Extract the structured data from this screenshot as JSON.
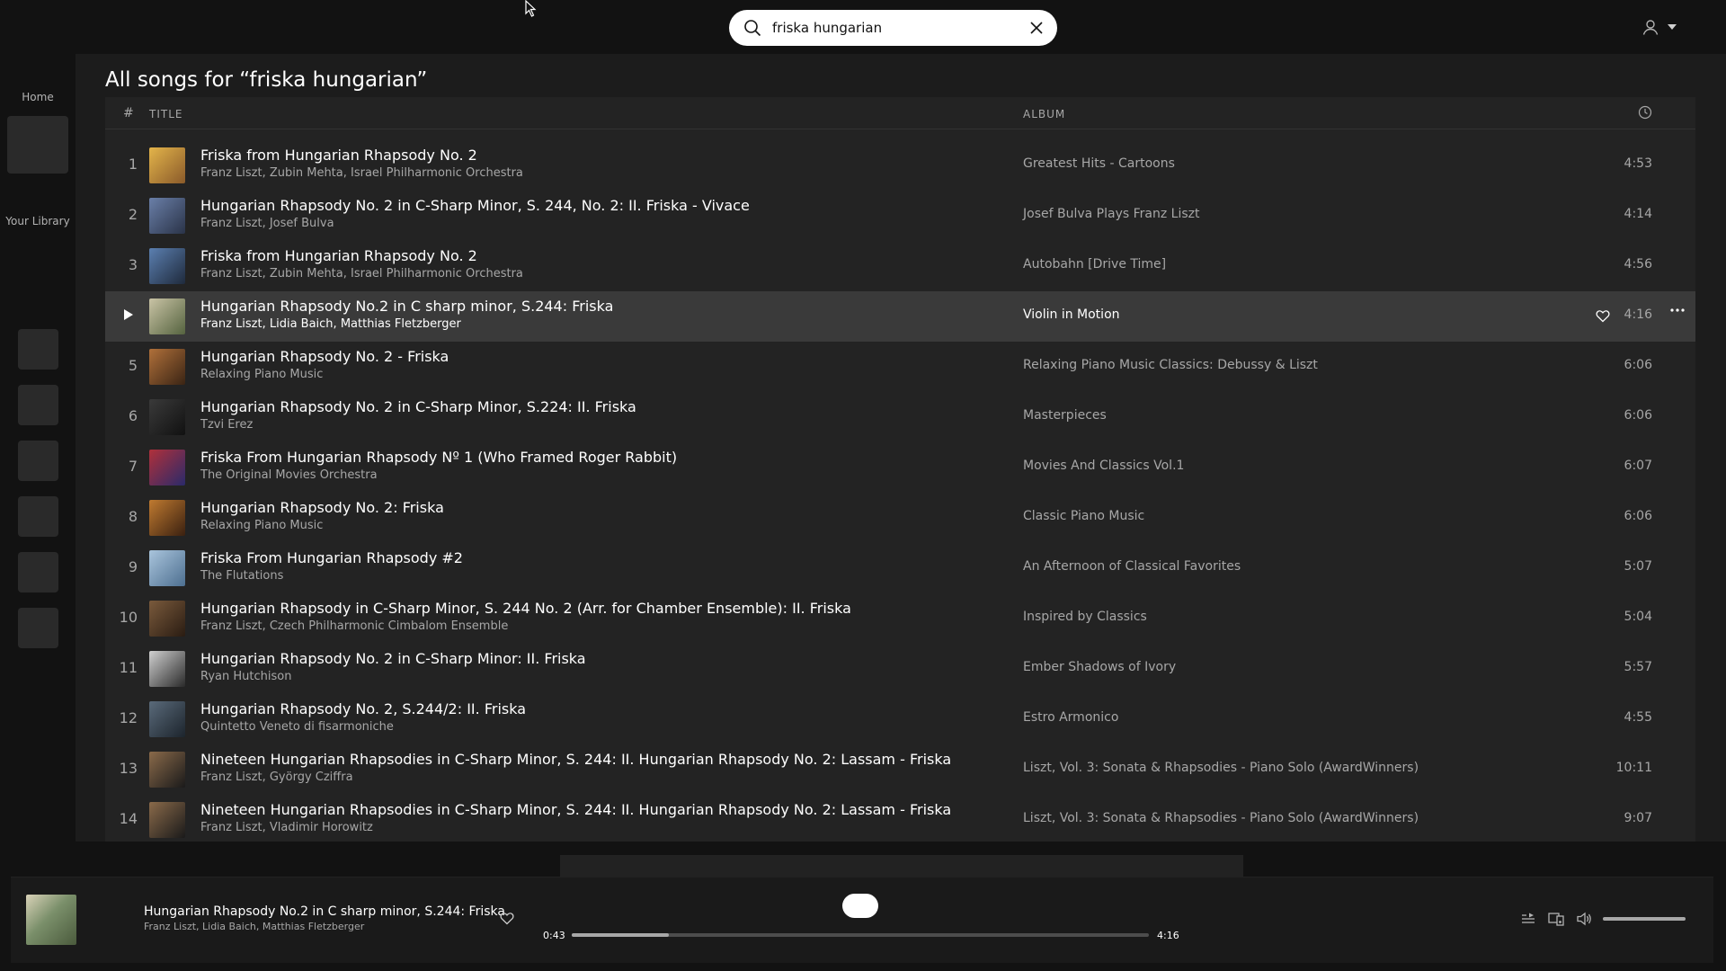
{
  "search": {
    "value": "friska hungarian",
    "placeholder": ""
  },
  "sidebar": {
    "home_label": "Home",
    "library_label": "Your Library"
  },
  "page_title": "All songs for “friska hungarian”",
  "table": {
    "headers": {
      "num": "#",
      "title": "TITLE",
      "album": "ALBUM",
      "duration_icon": "clock-icon"
    },
    "active_index": 3,
    "rows": [
      {
        "num": "1",
        "title": "Friska from Hungarian Rhapsody No. 2",
        "artists": "Franz Liszt, Zubin Mehta, Israel Philharmonic Orchestra",
        "album": "Greatest Hits - Cartoons",
        "duration": "4:53",
        "art": [
          "#e3b44a",
          "#8a5a2a"
        ]
      },
      {
        "num": "2",
        "title": "Hungarian Rhapsody No. 2 in C-Sharp Minor, S. 244, No. 2: II. Friska - Vivace",
        "artists": "Franz Liszt, Josef Bulva",
        "album": "Josef Bulva Plays Franz Liszt",
        "duration": "4:14",
        "art": [
          "#6a7fa8",
          "#2a3348"
        ]
      },
      {
        "num": "3",
        "title": "Friska from Hungarian Rhapsody No. 2",
        "artists": "Franz Liszt, Zubin Mehta, Israel Philharmonic Orchestra",
        "album": "Autobahn [Drive Time]",
        "duration": "4:56",
        "art": [
          "#5b7fb0",
          "#1f2a3c"
        ]
      },
      {
        "num": "",
        "title": "Hungarian Rhapsody No.2 in C sharp minor, S.244: Friska",
        "artists": "Franz Liszt, Lidia Baich, Matthias Fletzberger",
        "album": "Violin in Motion",
        "duration": "4:16",
        "art": [
          "#c9c3a5",
          "#55633f"
        ]
      },
      {
        "num": "5",
        "title": "Hungarian Rhapsody No. 2 - Friska",
        "artists": "Relaxing Piano Music",
        "album": "Relaxing Piano Music Classics: Debussy & Liszt",
        "duration": "6:06",
        "art": [
          "#b0703a",
          "#3a2414"
        ]
      },
      {
        "num": "6",
        "title": "Hungarian Rhapsody No. 2 in C-Sharp Minor, S.224: II. Friska",
        "artists": "Tzvi Erez",
        "album": "Masterpieces",
        "duration": "6:06",
        "art": [
          "#3a3a3a",
          "#111111"
        ]
      },
      {
        "num": "7",
        "title": "Friska From Hungarian Rhapsody Nº 1 (Who Framed Roger Rabbit)",
        "artists": "The Original Movies Orchestra",
        "album": "Movies And Classics Vol.1",
        "duration": "6:07",
        "art": [
          "#b0303a",
          "#2a2a6a"
        ]
      },
      {
        "num": "8",
        "title": "Hungarian Rhapsody No. 2: Friska",
        "artists": "Relaxing Piano Music",
        "album": "Classic Piano Music",
        "duration": "6:06",
        "art": [
          "#c07a30",
          "#3a2010"
        ]
      },
      {
        "num": "9",
        "title": "Friska From Hungarian Rhapsody #2",
        "artists": "The Flutations",
        "album": "An Afternoon of Classical Favorites",
        "duration": "5:07",
        "art": [
          "#a9c4dc",
          "#4d6f90"
        ]
      },
      {
        "num": "10",
        "title": "Hungarian Rhapsody in C-Sharp Minor, S. 244 No. 2 (Arr. for Chamber Ensemble): II. Friska",
        "artists": "Franz Liszt, Czech Philharmonic Cimbalom Ensemble",
        "album": "Inspired by Classics",
        "duration": "5:04",
        "art": [
          "#7a5a3c",
          "#2a1c12"
        ]
      },
      {
        "num": "11",
        "title": "Hungarian Rhapsody No. 2 in C-Sharp Minor: II. Friska",
        "artists": "Ryan Hutchison",
        "album": "Ember Shadows of Ivory",
        "duration": "5:57",
        "art": [
          "#d0d0d0",
          "#2a2a2a"
        ]
      },
      {
        "num": "12",
        "title": "Hungarian Rhapsody No. 2, S.244/2: II. Friska",
        "artists": "Quintetto Veneto di fisarmoniche",
        "album": "Estro Armonico",
        "duration": "4:55",
        "art": [
          "#5a6a7a",
          "#1c242c"
        ]
      },
      {
        "num": "13",
        "title": "Nineteen Hungarian Rhapsodies in C-Sharp Minor, S. 244: II. Hungarian Rhapsody No. 2: Lassam - Friska",
        "artists": "Franz Liszt, György Cziffra",
        "album": "Liszt, Vol. 3: Sonata & Rhapsodies - Piano Solo (AwardWinners)",
        "duration": "10:11",
        "art": [
          "#8a6a4a",
          "#1a1a1a"
        ]
      },
      {
        "num": "14",
        "title": "Nineteen Hungarian Rhapsodies in C-Sharp Minor, S. 244: II. Hungarian Rhapsody No. 2: Lassam - Friska",
        "artists": "Franz Liszt, Vladimir Horowitz",
        "album": "Liszt, Vol. 3: Sonata & Rhapsodies - Piano Solo (AwardWinners)",
        "duration": "9:07",
        "art": [
          "#8a6a4a",
          "#1a1a1a"
        ]
      }
    ]
  },
  "player": {
    "title": "Hungarian Rhapsody No.2 in C sharp minor, S.244: Friska",
    "artists": "Franz Liszt, Lidia Baich, Matthias Fletzberger",
    "position": "0:43",
    "duration": "4:16",
    "progress_fraction": 0.168,
    "volume_fraction": 1.0
  }
}
